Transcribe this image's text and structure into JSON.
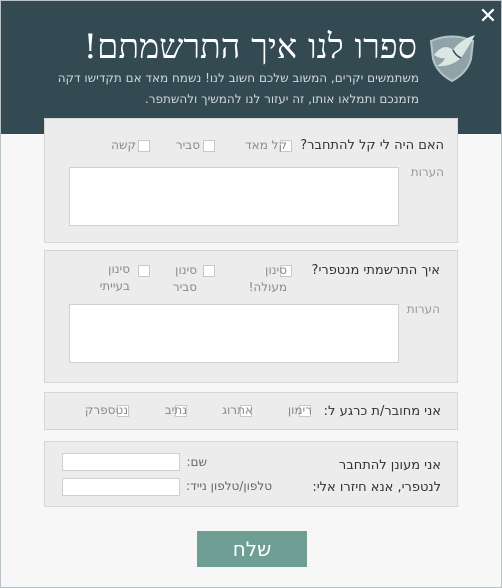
{
  "header": {
    "title": "ספרו לנו איך התרשמתם!",
    "subtitle_line1": "משתמשים יקרים, המשוב שלכם חשוב לנו! נשמח מאד אם תקדישו דקה",
    "subtitle_line2": "מזמנכם ותמלאו אותו, זה יעזור לנו להמשיך ולהשתפר.",
    "close_glyph": "✕",
    "logo_icon": "shield-bird-logo-icon"
  },
  "q1": {
    "question": "האם היה לי קל להתחבר?",
    "options": [
      "קל מאד",
      "סביר",
      "קשה"
    ],
    "notes_label": "הערות"
  },
  "q2": {
    "question": "איך התרשמתי מנטפרי?",
    "options": [
      {
        "line1": "סינון",
        "line2": "מעולה!"
      },
      {
        "line1": "סינון",
        "line2": "סביר"
      },
      {
        "line1": "סינון",
        "line2": "בעייתי"
      }
    ],
    "notes_label": "הערות"
  },
  "q3": {
    "question": "אני מחובר/ת כרגע ל:",
    "options": [
      "רימון",
      "אתרוג",
      "נתיב",
      "נטספרק"
    ]
  },
  "contact": {
    "text_line1": "אני מעונן להתחבר",
    "text_line2": "לנטפרי,  אנא חיזרו אלי:",
    "name_label": "שם:",
    "phone_label": "טלפון/טלפון נייד:"
  },
  "submit_label": "שלח",
  "colors": {
    "header_bg": "#344a52",
    "accent": "#6e9e94",
    "section_bg": "#ececec"
  }
}
